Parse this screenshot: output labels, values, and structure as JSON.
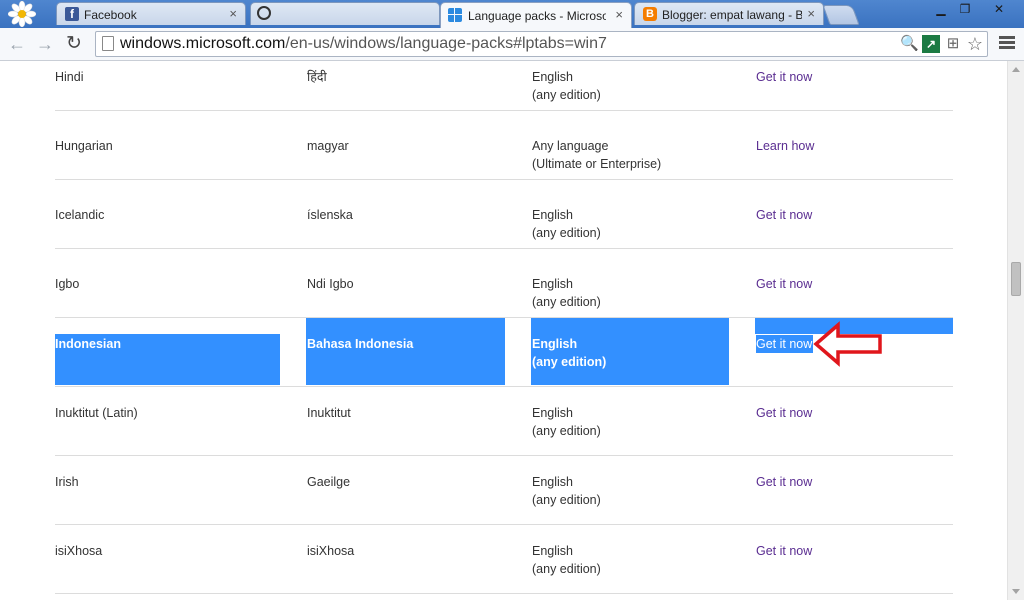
{
  "browser": {
    "tabs": [
      {
        "title": "Facebook",
        "icon": "facebook-icon",
        "color": "#3b5998",
        "close": "×"
      },
      {
        "title": "",
        "icon": "loading-icon",
        "color": "#555555",
        "close": ""
      },
      {
        "title": "Language packs - Microsoft W",
        "icon": "windows-logo-icon",
        "color": "#2b8ae0",
        "close": "×"
      },
      {
        "title": "Blogger: empat lawang - Buat",
        "icon": "blogger-icon",
        "color": "#f57d00",
        "close": "×"
      }
    ],
    "url_host": "windows.microsoft.com",
    "url_path": "/en-us/windows/language-packs#lptabs=win7",
    "window_controls": {
      "minimize": "▁",
      "maximize": "❐",
      "close": "✕"
    },
    "nav": {
      "back": "←",
      "forward": "→",
      "reload": "↻"
    },
    "omnibox_icons": {
      "zoom": "🔍",
      "extension": "↗",
      "translate": "⊞",
      "bookmark": "☆"
    }
  },
  "languages": [
    {
      "language": "Hindi",
      "native": "हिंदी",
      "requirement": [
        "English",
        "(any edition)"
      ],
      "download": "Get it now",
      "selected": false
    },
    {
      "language": "Hungarian",
      "native": "magyar",
      "requirement": [
        "Any language",
        "(Ultimate or Enterprise)"
      ],
      "download": "Learn how",
      "selected": false
    },
    {
      "language": "Icelandic",
      "native": "íslenska",
      "requirement": [
        "English",
        "(any edition)"
      ],
      "download": "Get it now",
      "selected": false
    },
    {
      "language": "Igbo",
      "native": "Ndi Igbo",
      "requirement": [
        "English",
        "(any edition)"
      ],
      "download": "Get it now",
      "selected": false
    },
    {
      "language": "Indonesian",
      "native": "Bahasa Indonesia",
      "requirement": [
        "English",
        "(any edition)"
      ],
      "download": "Get it now",
      "selected": true
    },
    {
      "language": "Inuktitut (Latin)",
      "native": "Inuktitut",
      "requirement": [
        "English",
        "(any edition)"
      ],
      "download": "Get it now",
      "selected": false
    },
    {
      "language": "Irish",
      "native": "Gaeilge",
      "requirement": [
        "English",
        "(any edition)"
      ],
      "download": "Get it now",
      "selected": false
    },
    {
      "language": "isiXhosa",
      "native": "isiXhosa",
      "requirement": [
        "English",
        "(any edition)"
      ],
      "download": "Get it now",
      "selected": false
    }
  ],
  "colors": {
    "selection": "#3390ff",
    "link": "#5a2d91",
    "annotation_arrow": "#e0161c"
  }
}
